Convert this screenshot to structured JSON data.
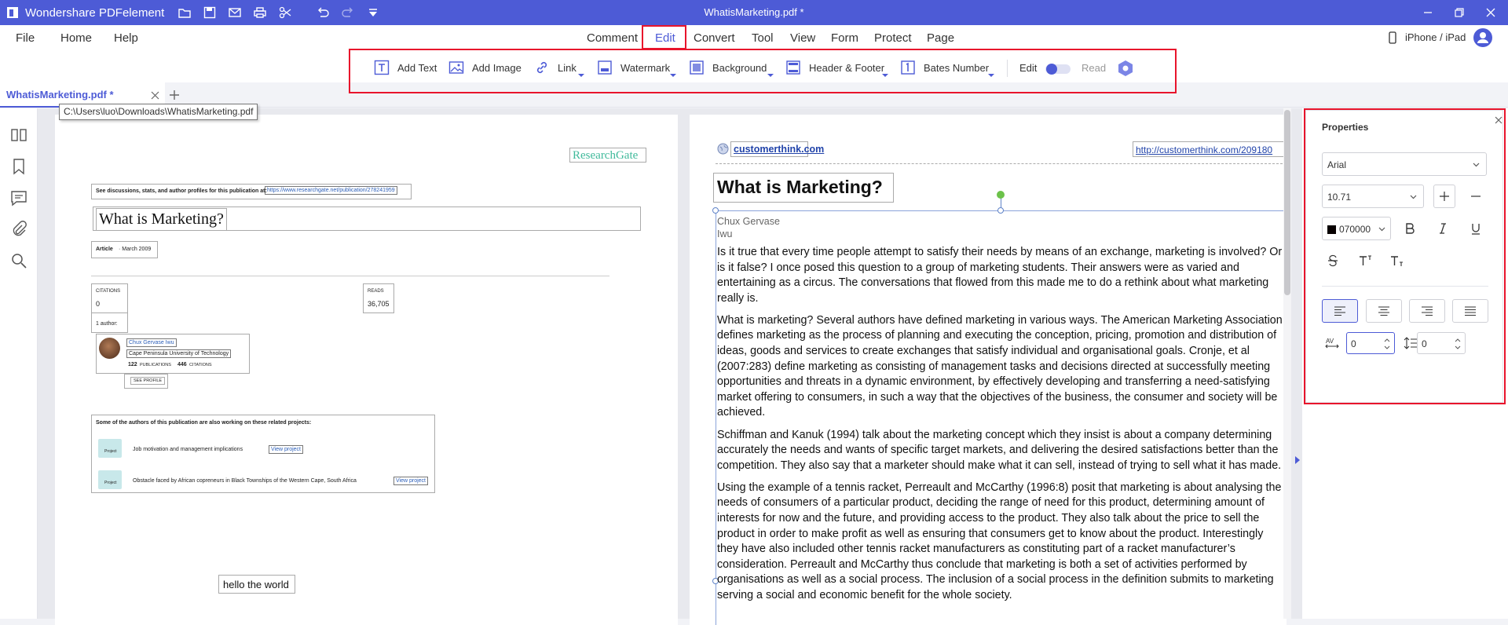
{
  "app": {
    "name": "Wondershare PDFelement",
    "document_title": "WhatisMarketing.pdf *"
  },
  "menus": {
    "left": [
      "File",
      "Home",
      "Help"
    ],
    "center": [
      "Comment",
      "Edit",
      "Convert",
      "Tool",
      "View",
      "Form",
      "Protect",
      "Page"
    ],
    "device": "iPhone / iPad"
  },
  "toolbar": {
    "add_text": "Add Text",
    "add_image": "Add Image",
    "link": "Link",
    "watermark": "Watermark",
    "background": "Background",
    "header_footer": "Header & Footer",
    "bates_number": "Bates Number",
    "edit": "Edit",
    "read": "Read"
  },
  "tab": {
    "label": "WhatisMarketing.pdf *",
    "tooltip": "C:\\Users\\luo\\Downloads\\WhatisMarketing.pdf"
  },
  "page1": {
    "rg_logo": "ResearchGate",
    "discussion": "See discussions, stats, and author profiles for this publication at:",
    "discussion_link": "https://www.researchgate.net/publication/278241959",
    "title": "What is Marketing?",
    "article_label": "Article",
    "article_date": " · March 2009",
    "citations_label": "CITATIONS",
    "citations_value": "0",
    "reads_label": "READS",
    "reads_value": "36,705",
    "author_count": "1 author:",
    "author_name": "Chux Gervase Iwu",
    "author_affil": "Cape Peninsula University of Technology",
    "author_pubs": "122",
    "pubs_label": "PUBLICATIONS",
    "author_cites": "446",
    "cites_label": "CITATIONS",
    "see_profile": "SEE PROFILE",
    "related_heading": "Some of the authors of this publication are also working on these related projects:",
    "project_tag": "Project",
    "project1": "Job motivation and management implications",
    "project1_link": "View project",
    "project2": "Obstacle faced by African copreneurs in Black Townships of the Western Cape, South Africa",
    "project2_link": "View project",
    "hello": "hello the world"
  },
  "page2": {
    "site": "customerthink.com",
    "url": "http://customerthink.com/209180",
    "title": "What is Marketing?",
    "author_line1": "Chux Gervase",
    "author_line2": "Iwu",
    "para1": "Is it true that every time people attempt to satisfy their needs by means of an exchange, marketing is involved? Or is it false? I once posed this question to a group of marketing students. Their answers were as varied and entertaining as a circus. The conversations that flowed from this made me to do a rethink about what marketing really is.",
    "para2": "What is marketing? Several authors have defined marketing in various ways. The American Marketing Association defines marketing as the process of planning and executing the conception, pricing, promotion and distribution of ideas, goods and services to create exchanges that satisfy individual and organisational goals. Cronje, et al (2007:283) define marketing as consisting of management tasks and decisions directed at successfully meeting opportunities and threats in a dynamic environment, by effectively developing and transferring a need-satisfying market offering to consumers, in such a way that the objectives of the business, the consumer and society will be achieved.",
    "para3": "Schiffman and Kanuk (1994) talk about the marketing concept which they insist is about a company determining accurately the needs and wants of specific target markets, and delivering the desired satisfactions better than the competition. They also say that a marketer should make what it can sell, instead of trying to sell what it has made.",
    "para4": "Using the example of a tennis racket, Perreault and McCarthy (1996:8) posit that marketing is about analysing the needs of consumers of a particular product, deciding the range of need for this product, determining amount of interests for now and the future, and providing access to the product. They also talk about the price to sell the product in order to make profit as well as ensuring that consumers get to know about the product. Interestingly they have also included other tennis racket manufacturers as constituting part of a racket manufacturer’s consideration. Perreault and McCarthy thus conclude that marketing is both a set of activities performed by organisations as well as a social process. The inclusion of a social process in the definition submits to marketing serving a social and economic benefit for the whole society."
  },
  "properties": {
    "title": "Properties",
    "font": "Arial",
    "size": "10.71",
    "color_value": "070000",
    "color_swatch": "#070000",
    "char_spacing": "0",
    "line_spacing": "0"
  },
  "colors": {
    "accent": "#4d5bd6",
    "highlight": "#e8142c"
  }
}
